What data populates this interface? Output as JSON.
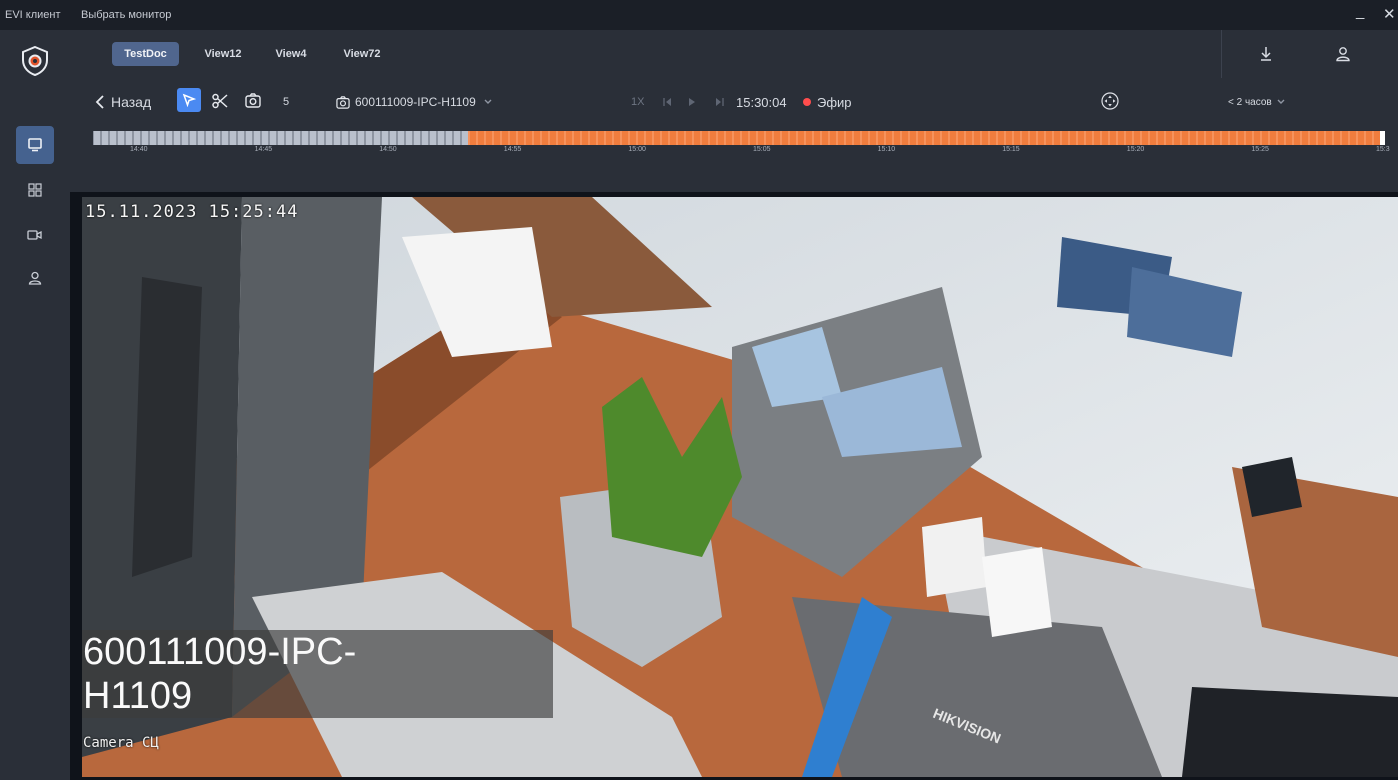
{
  "titlebar": {
    "app_name": "EVI клиент",
    "menu_select_monitor": "Выбрать монитор",
    "minimize": "_",
    "close": "✕"
  },
  "tabs": [
    {
      "label": "TestDoc",
      "active": true
    },
    {
      "label": "View12",
      "active": false
    },
    {
      "label": "View4",
      "active": false
    },
    {
      "label": "View72",
      "active": false
    }
  ],
  "toolbar": {
    "back_label": "Назад",
    "count": "5",
    "camera_name": "600111009-IPC-H1109",
    "speed": "1X",
    "time": "15:30:04",
    "live_label": "Эфир",
    "range_label": "< 2 часов"
  },
  "timeline": {
    "ticks": [
      "14:40",
      "14:45",
      "14:50",
      "14:55",
      "15:00",
      "15:05",
      "15:10",
      "15:15",
      "15:20",
      "15:25",
      "15:3"
    ],
    "recorded_from_fraction": 0.29,
    "recorded_color": "#f07d3e",
    "empty_color": "#b9c0cc"
  },
  "video": {
    "timestamp": "15.11.2023 15:25:44",
    "camera_title": "600111009-IPC-\nH1109",
    "camera_label": "Camera СЦ",
    "box_brand": "HIKVISION"
  },
  "colors": {
    "accent": "#4b8af2",
    "live_dot": "#ff4d4d"
  }
}
